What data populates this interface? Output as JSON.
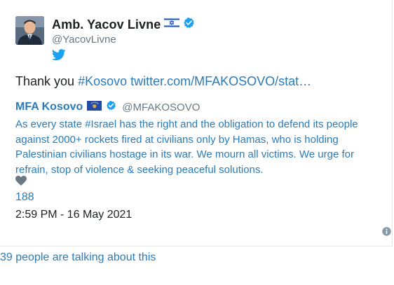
{
  "author": {
    "display_name": "Amb. Yacov Livne",
    "handle": "@YacovLivne",
    "flag_icon": "israel-flag-icon",
    "verified_icon": "verified-badge-icon",
    "avatar": "profile-photo"
  },
  "tweet": {
    "text_prefix": "Thank you ",
    "hashtag": "#Kosovo",
    "link": " twitter.com/MFAKOSOVO/stat…"
  },
  "quoted_tweet": {
    "display_name": "MFA Kosovo",
    "handle": "@MFAKOSOVO",
    "flag_icon": "kosovo-flag-icon",
    "verified_icon": "verified-badge-icon",
    "text": "As every state #Israel has the right and the obligation to defend its people against 2000+ rockets fired at civilians only by Hamas, who is holding Palestinian civilians hostage in its war. We mourn all victims. We urge for refrain, stop of violence & seeking peaceful solutions."
  },
  "engagement": {
    "heart_icon": "heart-icon",
    "likes": "188",
    "timestamp": "2:59 PM - 16 May 2021"
  },
  "footer": {
    "info_icon": "info-icon",
    "talking": "39 people are talking about this"
  },
  "colors": {
    "link": "#2b7bb9",
    "text": "#1c2022",
    "muted": "#697882",
    "twitter_blue": "#1da1f2"
  }
}
